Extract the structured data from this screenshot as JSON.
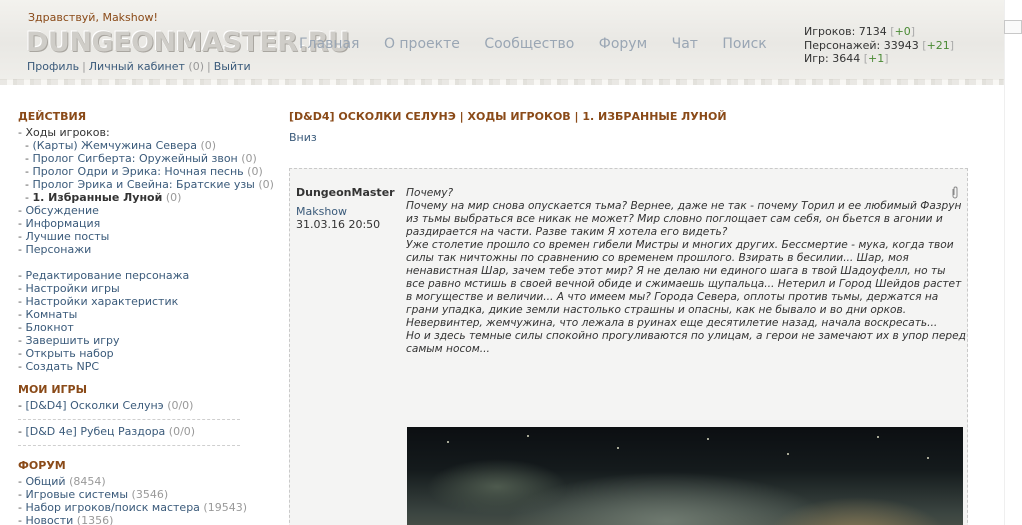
{
  "header": {
    "greeting": "Здравствуй, Makshow!",
    "logo": "DUNGEONMASTER.RU",
    "user_links": [
      {
        "label": "Профиль"
      },
      {
        "label": "Личный кабинет",
        "count": "(0)"
      },
      {
        "label": "Выйти"
      }
    ],
    "nav": [
      "Главная",
      "О проекте",
      "Сообщество",
      "Форум",
      "Чат",
      "Поиск"
    ],
    "stats": [
      {
        "label": "Игроков: 7134",
        "delta": "+0"
      },
      {
        "label": "Персонажей: 33943",
        "delta": "+21"
      },
      {
        "label": "Игр: 3644",
        "delta": "+1"
      }
    ]
  },
  "sidebar": {
    "actions_title": "ДЕЙСТВИЯ",
    "player_moves_label": "Ходы игроков:",
    "threads": [
      {
        "label": "(Карты) Жемчужина Севера",
        "count": "(0)"
      },
      {
        "label": "Пролог Сигберта: Оружейный звон",
        "count": "(0)"
      },
      {
        "label": "Пролог Одри и Эрика: Ночная песнь",
        "count": "(0)"
      },
      {
        "label": "Пролог Эрика и Свейна: Братские узы",
        "count": "(0)"
      },
      {
        "label": "1. Избранные Луной",
        "count": "(0)"
      }
    ],
    "links_a": [
      "Обсуждение",
      "Информация",
      "Лучшие посты",
      "Персонажи"
    ],
    "links_b": [
      "Редактирование персонажа",
      "Настройки игры",
      "Настройки характеристик",
      "Комнаты",
      "Блокнот",
      "Завершить игру",
      "Открыть набор",
      "Создать NPC"
    ],
    "my_games_title": "МОИ ИГРЫ",
    "my_games": [
      {
        "label": "[D&D4] Осколки Селунэ",
        "count": "(0/0)"
      },
      {
        "label": "[D&D 4e] Рубец Раздора",
        "count": "(0/0)"
      }
    ],
    "forum_title": "ФОРУМ",
    "forum": [
      {
        "label": "Общий",
        "count": "(8454)"
      },
      {
        "label": "Игровые системы",
        "count": "(3546)"
      },
      {
        "label": "Набор игроков/поиск мастера",
        "count": "(19543)"
      },
      {
        "label": "Новости",
        "count": "(1356)"
      }
    ]
  },
  "main": {
    "title": "[D&D4] ОСКОЛКИ СЕЛУНЭ | ХОДЫ ИГРОКОВ | 1. ИЗБРАННЫЕ ЛУНОЙ",
    "down_link": "Вниз",
    "post": {
      "author": "DungeonMaster",
      "user": "Makshow",
      "date": "31.03.16 20:50",
      "paragraphs": [
        "Почему?",
        "Почему на мир снова опускается тьма? Вернее, даже не так - почему Торил и ее любимый Фазрун из тьмы выбраться все никак не может? Мир словно поглощает сам себя, он бьется в агонии и раздирается на части. Разве таким Я хотела его видеть?",
        "Уже столетие прошло со времен гибели Мистры и многих других. Бессмертие - мука, когда твои силы так ничтожны по сравнению со временем прошлого. Взирать в бесилии... Шар, моя ненавистная Шар, зачем тебе этот мир? Я не делаю ни единого шага в твой Шадоуфелл, но ты все равно мстишь в своей вечной обиде и сжимаешь щупальца... Нетерил и Город Шейдов растет в могуществе и величии... А что имеем мы? Города Севера, оплоты против тьмы, держатся на грани упадка, дикие земли настолько страшны и опасны, как не бывало и во дни орков. Невервинтер, жемчужина, что лежала в руинах еще десятилетие назад, начала воскресать...",
        "Но и здесь темные силы спокойно прогуливаются по улицам, а герои не замечают их в упор перед самым носом..."
      ]
    }
  }
}
